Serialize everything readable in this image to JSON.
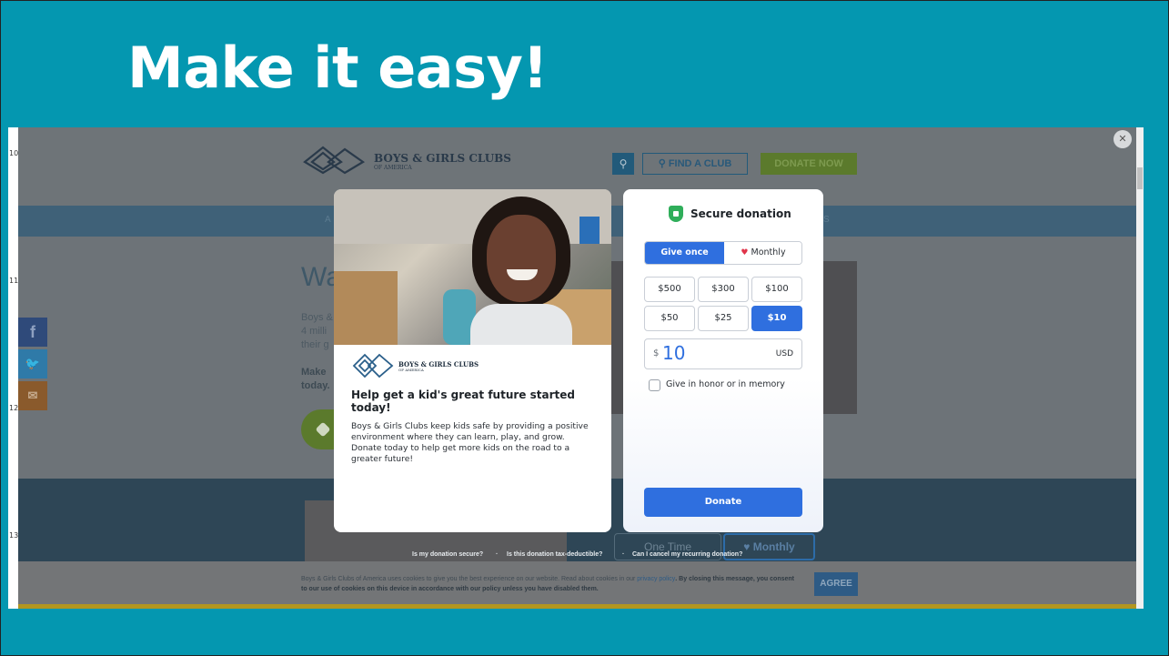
{
  "slide": {
    "title": "Make it easy!",
    "background": "#0497b0"
  },
  "row_numbers": [
    "10",
    "11",
    "12",
    "13"
  ],
  "site": {
    "logo_text": "BOYS & GIRLS CLUBS",
    "logo_sub": "OF AMERICA",
    "search_icon": "search-icon",
    "find_club": "FIND A CLUB",
    "donate_now": "DONATE NOW",
    "nav_left_fragment": "A",
    "nav_right_fragment": "S",
    "heading_fragment": "Wa",
    "para_lines": [
      "Boys &",
      "4 milli",
      "their g"
    ],
    "make_lines": [
      "Make",
      "today."
    ],
    "one_time": "One Time",
    "monthly": "Monthly",
    "cookie_text_1": "Boys & Girls Clubs of America uses cookies to give you the best experience on our website. Read about cookies in our",
    "cookie_link": "privacy policy",
    "cookie_text_2": ". By closing this message, you consent to our use of cookies on this device in accordance with our policy unless you have disabled them.",
    "agree": "AGREE",
    "social": {
      "facebook": "f",
      "twitter": "🐦",
      "email": "✉"
    }
  },
  "faq": {
    "q1": "Is my donation secure?",
    "q2": "Is this donation tax-deductible?",
    "q3": "Can I cancel my recurring donation?",
    "sep": "·"
  },
  "modal": {
    "close": "✕",
    "left_card": {
      "logo_text": "BOYS & GIRLS CLUBS",
      "logo_sub": "OF AMERICA",
      "heading": "Help get a kid's great future started today!",
      "body": "Boys & Girls Clubs keep kids safe by providing a positive environment where they can learn, play, and grow. Donate today to help get more kids on the road to a greater future!"
    },
    "right_card": {
      "secure_label": "Secure donation",
      "give_once": "Give once",
      "monthly": "Monthly",
      "amounts": [
        "$500",
        "$300",
        "$100",
        "$50",
        "$25",
        "$10"
      ],
      "selected_amount": "$10",
      "currency_symbol": "$",
      "amount_value": "10",
      "currency_code": "USD",
      "honor_label": "Give in honor or in memory",
      "donate_label": "Donate",
      "accent": "#2f6fdf"
    }
  }
}
